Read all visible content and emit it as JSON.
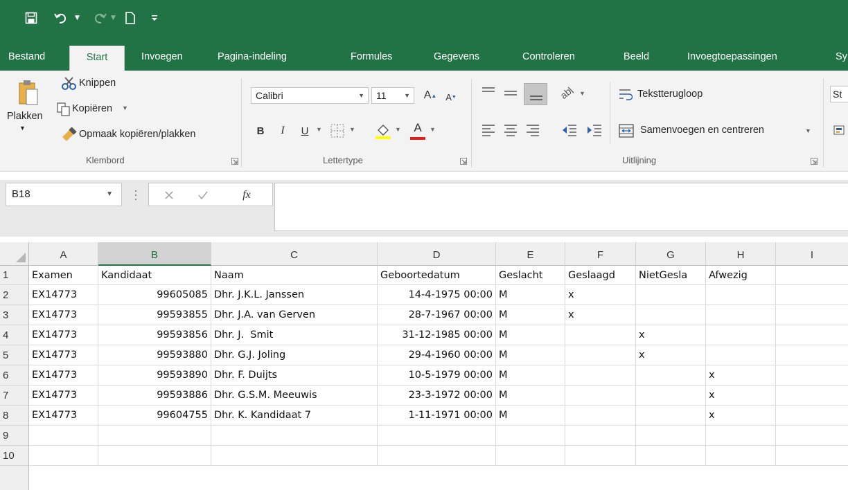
{
  "ribbon_tabs": [
    "Bestand",
    "Start",
    "Invoegen",
    "Pagina-indeling",
    "Formules",
    "Gegevens",
    "Controleren",
    "Beeld",
    "Invoegtoepassingen",
    "Sy"
  ],
  "active_tab": "Start",
  "clipboard": {
    "paste": "Plakken",
    "cut": "Knippen",
    "copy": "Kopiëren",
    "format_painter": "Opmaak kopiëren/plakken",
    "group": "Klembord"
  },
  "font": {
    "name": "Calibri",
    "size": "11",
    "bold": "B",
    "italic": "I",
    "underline": "U",
    "group": "Lettertype"
  },
  "alignment": {
    "wrap_text": "Tekstterugloop",
    "merge_center": "Samenvoegen en centreren",
    "group": "Uitlijning"
  },
  "styles_partial": "St",
  "formula_bar": {
    "name_box": "B18",
    "fx": "fx",
    "value": ""
  },
  "grid": {
    "columns": [
      "A",
      "B",
      "C",
      "D",
      "E",
      "F",
      "G",
      "H",
      "I"
    ],
    "selected_column": "B",
    "row_numbers": [
      "1",
      "2",
      "3",
      "4",
      "5",
      "6",
      "7",
      "8",
      "9",
      "10"
    ],
    "rows": [
      [
        "Examen",
        "Kandidaat",
        "Naam",
        "Geboortedatum",
        "Geslacht",
        "Geslaagd",
        "NietGesla",
        "Afwezig",
        ""
      ],
      [
        "EX14773",
        "99605085",
        "Dhr. J.K.L. Janssen",
        "14-4-1975 00:00",
        "M",
        "x",
        "",
        "",
        ""
      ],
      [
        "EX14773",
        "99593855",
        "Dhr. J.A. van Gerven",
        "28-7-1967 00:00",
        "M",
        "x",
        "",
        "",
        ""
      ],
      [
        "EX14773",
        "99593856",
        "Dhr. J.  Smit",
        "31-12-1985 00:00",
        "M",
        "",
        "x",
        "",
        ""
      ],
      [
        "EX14773",
        "99593880",
        "Dhr. G.J. Joling",
        "29-4-1960 00:00",
        "M",
        "",
        "x",
        "",
        ""
      ],
      [
        "EX14773",
        "99593890",
        "Dhr. F. Duijts",
        "10-5-1979 00:00",
        "M",
        "",
        "",
        "x",
        ""
      ],
      [
        "EX14773",
        "99593886",
        "Dhr. G.S.M. Meeuwis",
        "23-3-1972 00:00",
        "M",
        "",
        "",
        "x",
        ""
      ],
      [
        "EX14773",
        "99604755",
        "Dhr. K. Kandidaat 7",
        "1-11-1971 00:00",
        "M",
        "",
        "",
        "x",
        ""
      ],
      [
        "",
        "",
        "",
        "",
        "",
        "",
        "",
        "",
        ""
      ],
      [
        "",
        "",
        "",
        "",
        "",
        "",
        "",
        "",
        ""
      ]
    ]
  }
}
